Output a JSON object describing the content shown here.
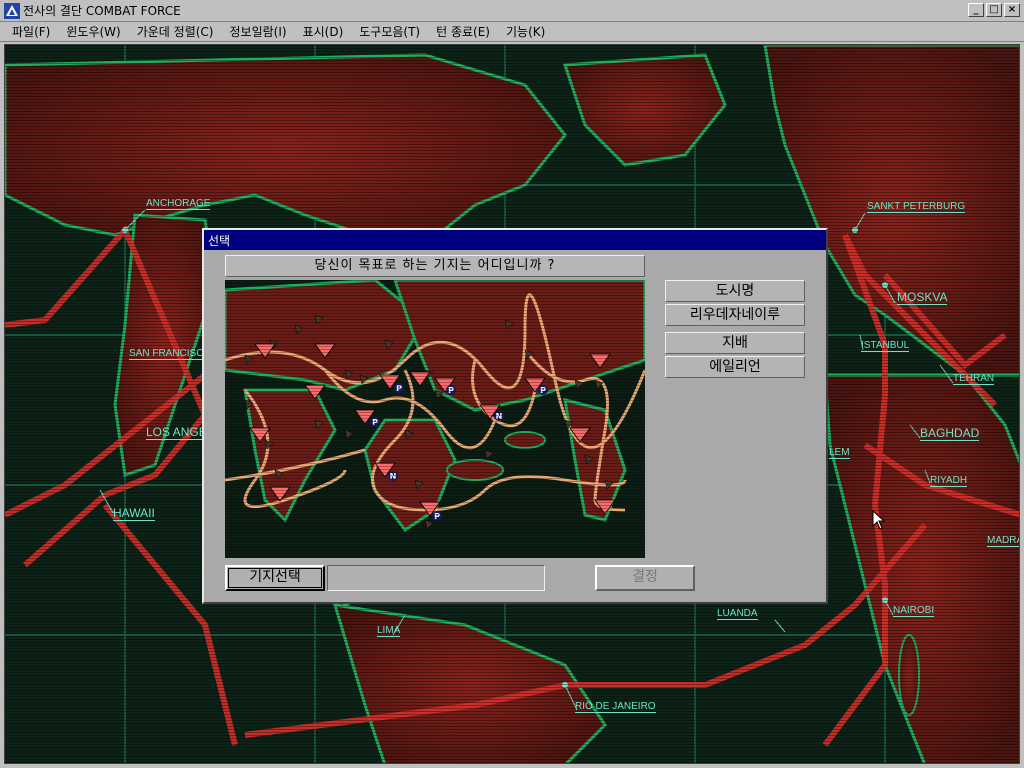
{
  "window": {
    "title": "전사의 결단 COMBAT FORCE",
    "controls": {
      "minimize": "_",
      "maximize": "□",
      "close": "×"
    }
  },
  "menu": [
    "파일(F)",
    "윈도우(W)",
    "가운데 정렬(C)",
    "정보일람(I)",
    "표시(D)",
    "도구모음(T)",
    "턴 종료(E)",
    "기능(K)"
  ],
  "map": {
    "cities": {
      "anchorage": "ANCHORAGE",
      "sankt_peterburg": "SANKT PETERBURG",
      "moskva": "MOSKVA",
      "san_francisco": "SAN FRANCISCO",
      "istanbul": "ISTANBUL",
      "tehran": "TEHRAN",
      "los_angeles": "LOS ANGE",
      "baghdad": "BAGHDAD",
      "salem": "LEM",
      "riyadh": "RIYADH",
      "hawaii": "HAWAII",
      "madras": "MADRA",
      "nairobi": "NAIROBI",
      "luanda": "LUANDA",
      "lima": "LIMA",
      "rio": "RIO DE JANEIRO"
    }
  },
  "dialog": {
    "title": "선택",
    "question": "당신이 목표로 하는 기지는 어디입니까 ?",
    "options": {
      "city_name_header": "도시명",
      "city_name_value": "리우데자네이루",
      "control_header": "지배",
      "control_value": "에일리언"
    },
    "base_select_button": "기지선택",
    "base_field_value": "",
    "decide_button": "결정",
    "marker_letters": [
      "P",
      "P",
      "P",
      "N",
      "P",
      "N",
      "P"
    ]
  },
  "colors": {
    "title_bar_active": "#000080",
    "map_land": "#6b1c17",
    "map_coast": "#1fae5e",
    "route_red": "#d8302a",
    "route_orange": "#f4b07a",
    "label_cyan": "#6ee3c8"
  }
}
